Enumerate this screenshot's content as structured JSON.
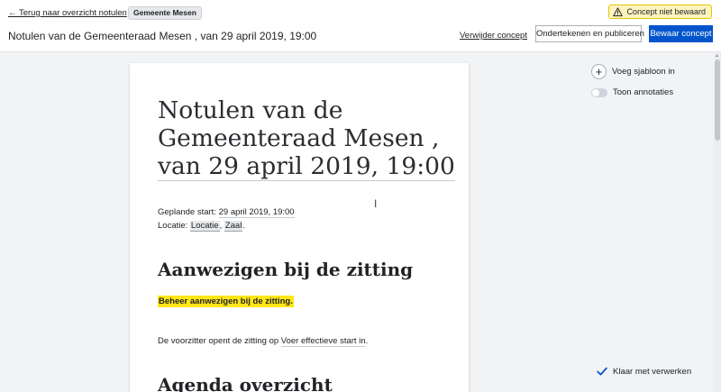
{
  "header": {
    "back_link": "← Terug naar overzicht notulen",
    "municipality_pill": "Gemeente Mesen",
    "status_badge": "Concept niet bewaard",
    "document_title": "Notulen van de Gemeenteraad Mesen , van 29 april 2019, 19:00",
    "delete_link": "Verwijder concept",
    "sign_publish_button": "Ondertekenen en publiceren",
    "save_button": "Bewaar concept"
  },
  "document": {
    "title_line1": "Notulen van de",
    "title_line2": "Gemeenteraad Mesen  ,",
    "title_line3": "van 29 april 2019, 19:00",
    "planned_start_label": "Geplande start: ",
    "planned_start_value": "29 april 2019, 19:00",
    "location_label": "Locatie: ",
    "location_chip": "Locatie",
    "location_sep": ", ",
    "room_chip": "Zaal",
    "location_end": ".",
    "section1_heading": "Aanwezigen bij de zitting",
    "manage_attendees": "Beheer aanwezigen bij de zitting.",
    "opening_prefix": "De voorzitter opent de zitting op ",
    "opening_placeholder": "Voer effectieve start in",
    "opening_suffix": ".",
    "section2_heading": "Agenda overzicht"
  },
  "sidebar": {
    "insert_template": "Voeg sjabloon in",
    "show_annotations": "Toon annotaties",
    "annotations_enabled": false
  },
  "footer": {
    "done_processing": "Klaar met verwerken"
  },
  "colors": {
    "primary": "#0055cc",
    "highlight": "#ffe615",
    "warning_bg": "#fff4bf"
  }
}
